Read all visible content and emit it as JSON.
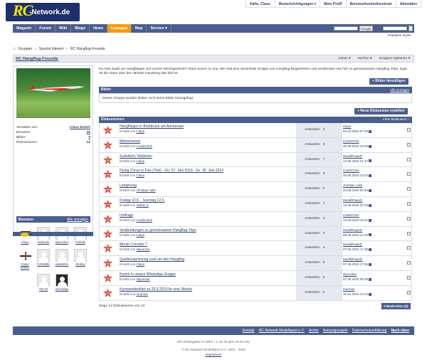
{
  "logo": {
    "rc": "RC",
    "net": "-Network.de"
  },
  "toplinks": [
    "Hallo, Claus.",
    "Benachrichtigungen ▾",
    "Mein Profil",
    "Benutzerkontrollzentrum",
    "Abmelden"
  ],
  "nav": {
    "items": [
      "Magazin",
      "Forum",
      "Wiki",
      "Blogs",
      "News",
      "Lounges",
      "Map",
      "Service ▾"
    ],
    "active_index": 5
  },
  "search": {
    "button1": "Google",
    "advanced": "Erweiterte Suche"
  },
  "breadcrumb": [
    "Gruppen",
    "Special Interest",
    "RC Hangflug-Freunde"
  ],
  "group": {
    "title": "RC Hangflug-Freunde",
    "tools": [
      "Admin ▾",
      "Suchen ▾",
      "Gruppen-Optionen ▾"
    ]
  },
  "sidebar": {
    "info": [
      {
        "label": "Verwaltet von:",
        "value": "Claus Eckert"
      },
      {
        "label": "Benutzer:",
        "value": "35"
      },
      {
        "label": "Bilder:",
        "value": "0"
      },
      {
        "label": "Diskussionen:",
        "value": "12"
      }
    ],
    "members_title": "Benutzer",
    "members_all": "Alle anzeigen",
    "members": [
      "Claus",
      "Schlecki",
      "skyrocker",
      "Fridolin",
      "Claus Eckert",
      "DJ0ott85",
      "waldo001",
      "Strattor",
      "TM-23",
      "msmalfgs"
    ]
  },
  "intro": "Du hast Spaß am Hangfliegen und suchst Gleichgesinnte? Dann komm zu uns. Wir sind eine dezentrale Gruppe von Hangflug-Begeisterten und verabreden uns hier zu gemeinsamen Hangflug Trips. Egal, ob die Alpen oder der nächste Hausberg das Ziel ist.",
  "buttons": {
    "add_images": "+ Bilder hinzufügen",
    "new_discussion": "+ Neue Diskussion erstellen",
    "moderation": "▾ Moderation (0)"
  },
  "images_section": {
    "title": "Bilder",
    "all": "Alle anzeigen",
    "empty": "Dieser Gruppe wurden bisher noch keine Bilder hinzugefügt."
  },
  "discussions": {
    "title": "Diskussionen",
    "moderation_label": "Inline-Moderation □",
    "created_by_prefix": "Erstellt von",
    "answers_label": "Antworten",
    "rows": [
      {
        "title": "Hangfliegen in Breitbrunn am Ammersee",
        "author": "Claus",
        "answers": "2",
        "last_user": "Claus",
        "last_time": "03.10.2019 07:05"
      },
      {
        "title": "Mahrenmoos",
        "author": "CrashChris",
        "answers": "0",
        "last_user": "CrashChris",
        "last_time": "28.08.2019 10:29"
      },
      {
        "title": "Sudelfeld / Walkerkn",
        "author": "Claus",
        "answers": "7",
        "last_user": "ModellRapidz",
        "last_time": "12.08.2019 21:17"
      },
      {
        "title": "Flying Circus in Fiss (Tirol) - Do. 27. Juni 2019 - So. 30. Juni 2019",
        "author": "Claus",
        "answers": "3",
        "last_user": "CrashChris",
        "last_time": "30.08.2019 12:43"
      },
      {
        "title": "Langeroog",
        "author": "christian cakli",
        "answers": "0",
        "last_user": "christian cakli",
        "last_time": "26.05.2019 00:43"
      },
      {
        "title": "Freitag 10.5. - Sonntag 12.5.",
        "author": "Stefan S",
        "answers": "7",
        "last_user": "ModellRapidz",
        "last_time": "14.05.2019 21:03"
      },
      {
        "title": "Umfrage",
        "author": "CrashChris",
        "answers": "4",
        "last_user": "CrashChris",
        "last_time": "13.05.2019 19:31"
      },
      {
        "title": "Verabredungen zu gemeinsamen Hangflug-Trips",
        "author": "Claus",
        "answers": "2",
        "last_user": "ModellRapidz",
        "last_time": "08.05.2019 11:19"
      },
      {
        "title": "Monte Cornetto ?",
        "author": "skyrocker",
        "answers": "4",
        "last_user": "ModellRapidz",
        "last_time": "07.05.2019 17:38"
      },
      {
        "title": "Quellensammlung rund um den Hangflug",
        "author": "Claus",
        "answers": "6",
        "last_user": "ModellRapidz",
        "last_time": "07.05.2019 17:36"
      },
      {
        "title": "Komm in unsere WhatsApp Gruppe",
        "author": "skyrocker",
        "answers": "0",
        "last_user": "skyrocker",
        "last_time": "07.05.2019 08:29"
      },
      {
        "title": "Kurzwenderblick zu 25.5.2019 für eine Woche",
        "author": "murmax",
        "answers": "0",
        "last_user": "murmax",
        "last_time": "15.04.2019 10:13"
      }
    ],
    "count_text": "Zeige 12 Diskussionen von 12"
  },
  "footer": {
    "links": [
      "Kontakt",
      "RC-Network Modellsport e.V.",
      "Archiv",
      "Nutzungsregeln",
      "Datenschutzerklärung",
      "Nach oben"
    ],
    "times": "Alle Zeitangaben in WEZ +1. Es ist jetzt 10:29 Uhr.",
    "copyright": "© RC-Network Modellsport e.V. 2002 - 2019",
    "impressum": "Impressum"
  },
  "colors": {
    "nav": "#4a5d8e",
    "active_tab": "#f39c12",
    "link": "#2b3e6b",
    "logo_bg": "#1e2f6b",
    "logo_rc": "#f7e400"
  }
}
